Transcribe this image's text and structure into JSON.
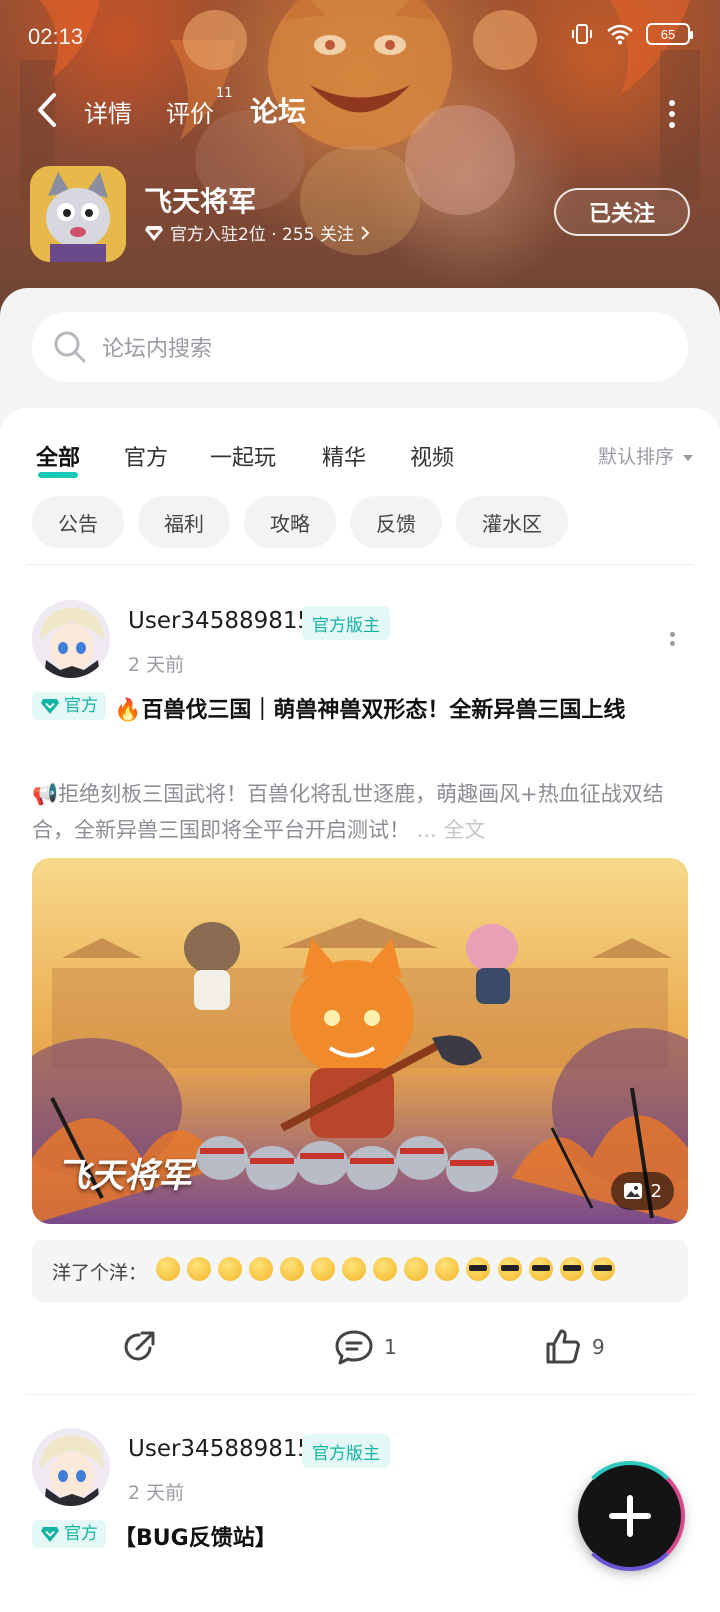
{
  "status": {
    "time": "02:13",
    "battery": "65"
  },
  "nav": {
    "tabs": [
      {
        "label": "详情"
      },
      {
        "label": "评价",
        "badge": "11"
      },
      {
        "label": "论坛",
        "active": true
      }
    ]
  },
  "game": {
    "name": "飞天将军",
    "meta": "官方入驻2位 · 255 关注",
    "follow_label": "已关注"
  },
  "search": {
    "placeholder": "论坛内搜索"
  },
  "categories": {
    "tabs": [
      "全部",
      "官方",
      "一起玩",
      "精华",
      "视频"
    ],
    "active": "全部",
    "sort": "默认排序"
  },
  "chips": [
    "公告",
    "福利",
    "攻略",
    "反馈",
    "灌水区"
  ],
  "posts": [
    {
      "user": "User345889815",
      "badge": "官方版主",
      "time": "2 天前",
      "tag": "官方",
      "title": "🔥百兽伐三国｜萌兽神兽双形态！全新异兽三国上线",
      "excerpt": "📢拒绝刻板三国武将！百兽化将乱世逐鹿，萌趣画风+热血征战双结合，全新异兽三国即将全平台开启测试！",
      "excerpt_more": " ... 全文",
      "image_logo": "飞天将军",
      "image_count": "2",
      "reaction_user": "洋了个洋：",
      "comments": "1",
      "likes": "9"
    },
    {
      "user": "User345889815",
      "badge": "官方版主",
      "time": "2 天前",
      "tag": "官方",
      "title": "【BUG反馈站】"
    }
  ],
  "icons": {
    "back": "chevron-left-icon",
    "more": "more-vertical-icon",
    "search": "search-icon",
    "share": "share-icon",
    "comment": "comment-icon",
    "like": "thumbs-up-icon",
    "add": "plus-icon"
  },
  "colors": {
    "accent": "#17c8b6",
    "badge_bg": "#e4f8f6",
    "badge_text": "#13b3a3"
  }
}
